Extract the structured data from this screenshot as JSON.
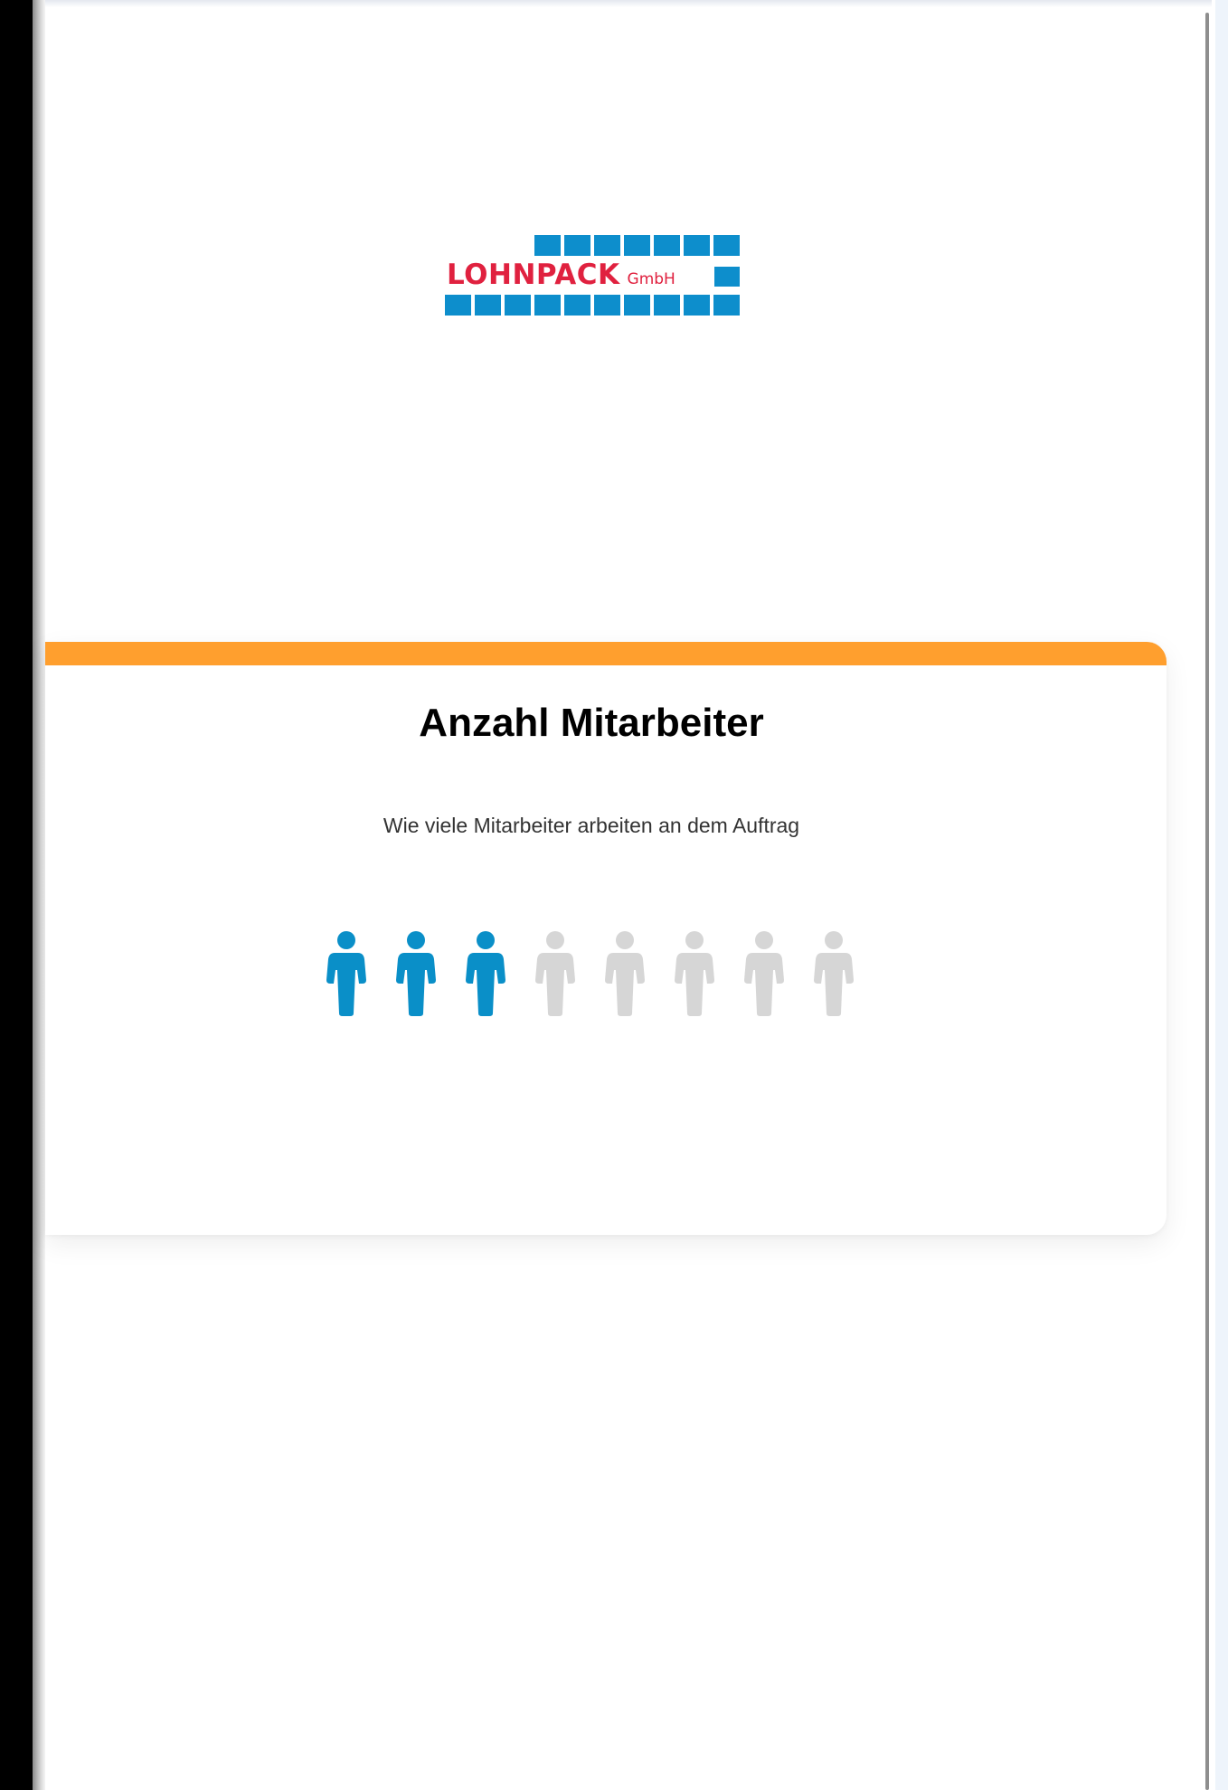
{
  "logo": {
    "brand": "LOHNPACK",
    "suffix": "GmbH"
  },
  "question": {
    "title": "Anzahl Mitarbeiter",
    "description": "Wie viele Mitarbeiter arbeiten an dem Auftrag"
  },
  "rating": {
    "icon": "person-icon",
    "selected": 3,
    "max": 8,
    "active_color": "#0a8fc8",
    "inactive_color": "#d6d6d6"
  },
  "colors": {
    "accent": "#ff9f2e",
    "logo_red": "#e0213f",
    "logo_blue": "#0d8ecc"
  }
}
